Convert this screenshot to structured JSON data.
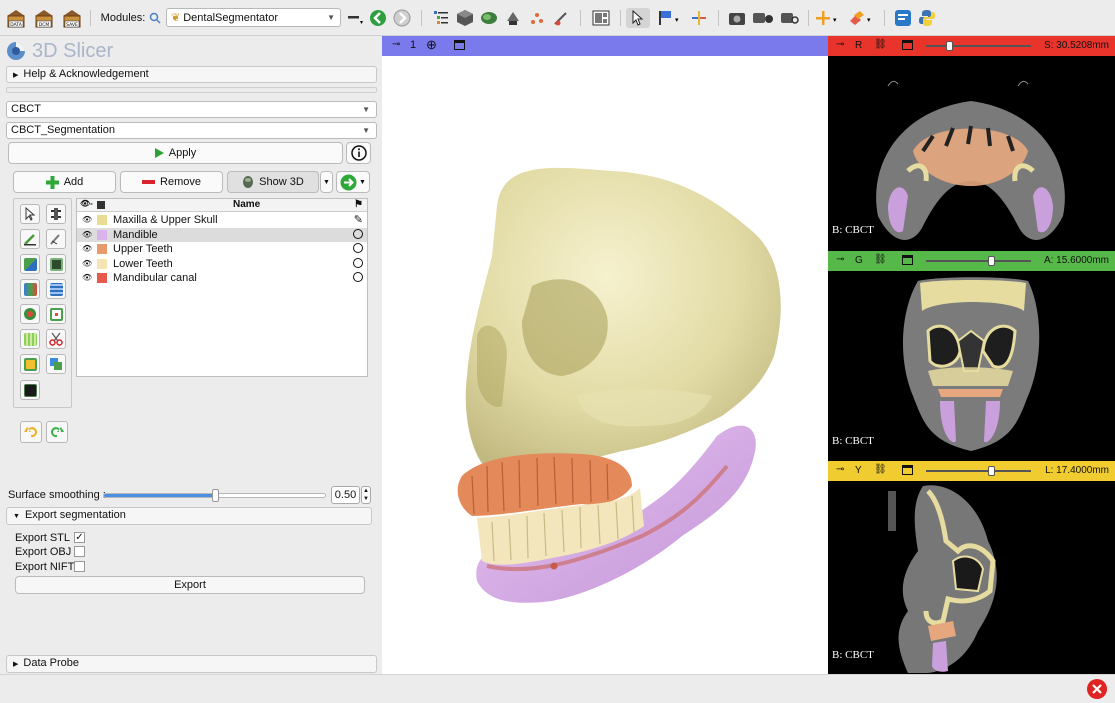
{
  "toolbar": {
    "data_label": "DATA",
    "dcm_label": "DCM",
    "save_label": "SAVE",
    "modules_label": "Modules:",
    "module_value": "DentalSegmentator"
  },
  "panel": {
    "app_title": "3D Slicer",
    "help_label": "Help & Acknowledgement",
    "volume_value": "CBCT",
    "segmentation_value": "CBCT_Segmentation",
    "apply_label": "Apply",
    "add_label": "Add",
    "remove_label": "Remove",
    "show3d_label": "Show 3D",
    "table_header_name": "Name",
    "segments": [
      {
        "name": "Maxilla & Upper Skull",
        "color": "#e9dd95"
      },
      {
        "name": "Mandible",
        "color": "#d9b3ec"
      },
      {
        "name": "Upper Teeth",
        "color": "#e99a6d"
      },
      {
        "name": "Lower Teeth",
        "color": "#f4e5b3"
      },
      {
        "name": "Mandibular canal",
        "color": "#e55a4a"
      }
    ],
    "smoothing_label": "Surface smoothing :",
    "smoothing_value": "0.50",
    "smoothing_fraction": 0.5,
    "export_section_label": "Export segmentation",
    "export_stl_label": "Export STL",
    "export_obj_label": "Export OBJ",
    "export_nifti_label": "Export NIFTI",
    "export_stl_checked": true,
    "export_obj_checked": false,
    "export_nifti_checked": false,
    "export_button_label": "Export",
    "data_probe_label": "Data Probe"
  },
  "view3d": {
    "index_label": "1",
    "bar_color": "#7a7aec"
  },
  "slices": [
    {
      "letter": "R",
      "value": "S: 30.5208mm",
      "color": "#e8342a",
      "volume_label": "B: CBCT",
      "slider_fraction": 0.22
    },
    {
      "letter": "G",
      "value": "A: 15.6000mm",
      "color": "#57b84a",
      "volume_label": "B: CBCT",
      "slider_fraction": 0.62
    },
    {
      "letter": "Y",
      "value": "L: 17.4000mm",
      "color": "#f0cc30",
      "volume_label": "B: CBCT",
      "slider_fraction": 0.62
    }
  ]
}
